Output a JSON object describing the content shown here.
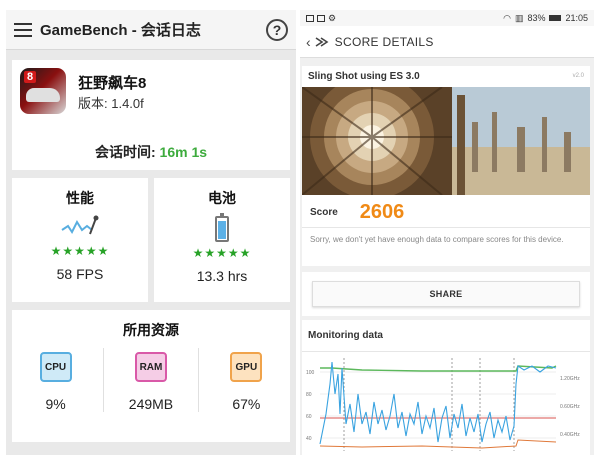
{
  "left": {
    "app_title": "GameBench - 会话日志",
    "help_label": "?",
    "app": {
      "name": "狂野飙车8",
      "icon_badge": "8",
      "version": "版本: 1.4.0f"
    },
    "session": {
      "label": "会话时间: ",
      "value": "16m 1s"
    },
    "performance": {
      "title": "性能",
      "stars": "★★★★★",
      "value": "58 FPS"
    },
    "battery": {
      "title": "电池",
      "stars": "★★★★★",
      "value": "13.3 hrs"
    },
    "resources": {
      "title": "所用资源",
      "items": [
        {
          "chip": "CPU",
          "value": "9%"
        },
        {
          "chip": "RAM",
          "value": "249MB"
        },
        {
          "chip": "GPU",
          "value": "67%"
        }
      ]
    }
  },
  "right": {
    "status": {
      "battery": "83%",
      "time": "21:05"
    },
    "header_title": "SCORE DETAILS",
    "test_name": "Sling Shot using ES 3.0",
    "test_version": "v2.0",
    "score_label": "Score",
    "score_value": "2606",
    "sorry_text": "Sorry, we don't yet have enough data to compare scores for this device.",
    "share_label": "SHARE",
    "monitoring_title": "Monitoring data",
    "monitoring": {
      "y_left_ticks": [
        "100",
        "80",
        "60",
        "40"
      ],
      "y_right_ticks": [
        "1.20GHz",
        "0.60GHz",
        "0.40GHz"
      ],
      "colors": {
        "fps": "#3aa3e0",
        "cpu_freq": "#5cb85c",
        "temp": "#e0793a",
        "battery": "#d9534f"
      }
    }
  }
}
